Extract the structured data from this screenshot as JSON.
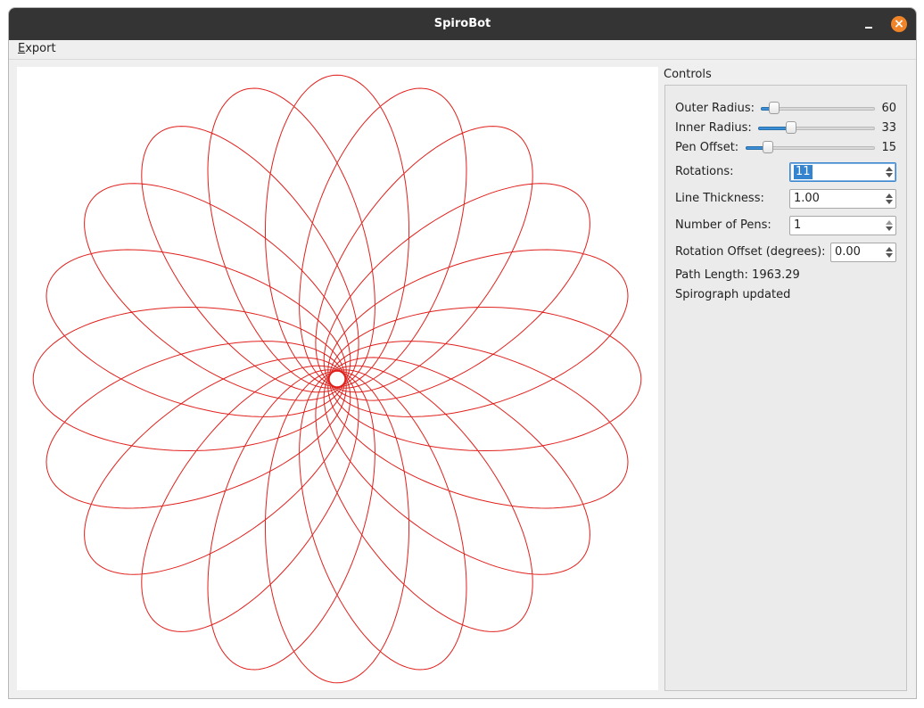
{
  "window": {
    "title": "SpiroBot"
  },
  "menubar": {
    "export_first": "E",
    "export_rest": "xport"
  },
  "controls": {
    "group_title": "Controls",
    "outer_radius": {
      "label": "Outer Radius:",
      "value": "60",
      "fraction": 0.12
    },
    "inner_radius": {
      "label": "Inner Radius:",
      "value": "33",
      "fraction": 0.28
    },
    "pen_offset": {
      "label": "Pen Offset:",
      "value": "15",
      "fraction": 0.17
    },
    "rotations": {
      "label": "Rotations:",
      "value": "11"
    },
    "line_thickness": {
      "label": "Line Thickness:",
      "value": "1.00"
    },
    "number_of_pens": {
      "label": "Number of Pens:",
      "value": "1"
    },
    "rotation_offset": {
      "label": "Rotation Offset (degrees):",
      "value": "0.00"
    },
    "path_length": "Path Length: 1963.29",
    "status": "Spirograph updated"
  },
  "drawing": {
    "color": "#e0201c",
    "petals": 20
  }
}
